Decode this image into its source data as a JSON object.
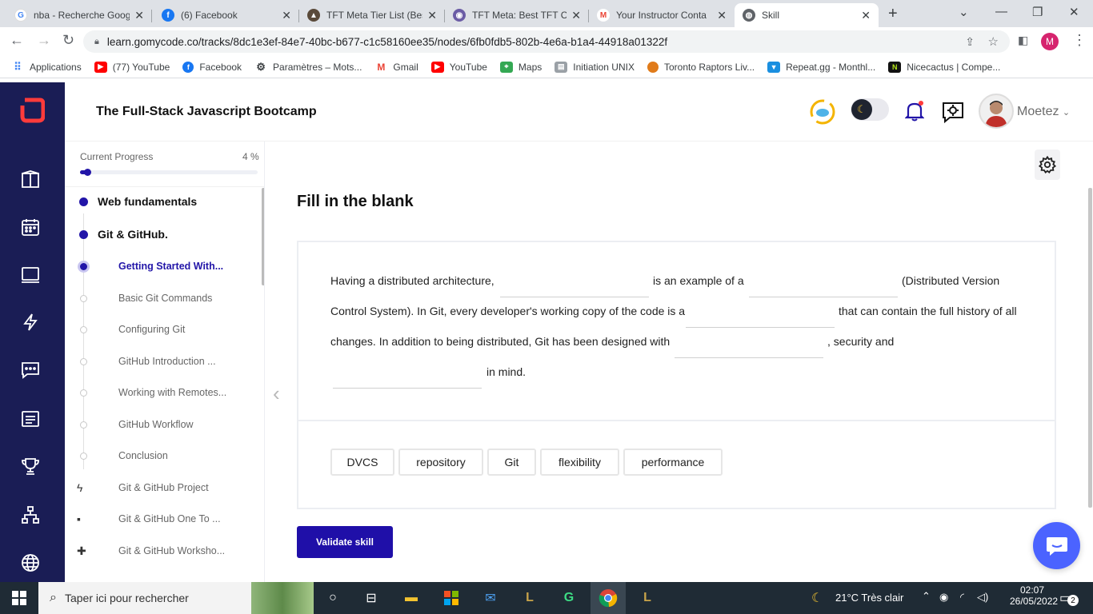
{
  "browser": {
    "tabs": [
      {
        "title": "nba - Recherche Goog",
        "favicon": "google-icon",
        "color": "#4285f4",
        "glyph": "G"
      },
      {
        "title": "(6) Facebook",
        "favicon": "facebook-icon",
        "color": "#1877f2",
        "glyph": "f"
      },
      {
        "title": "TFT Meta Tier List (Bes",
        "favicon": "tft-icon",
        "color": "#5a4a3a",
        "glyph": "▲"
      },
      {
        "title": "TFT Meta: Best TFT Co",
        "favicon": "tft-meta-icon",
        "color": "#6b5ca5",
        "glyph": "◉"
      },
      {
        "title": "Your Instructor Conta",
        "favicon": "gmail-icon",
        "color": "#ea4335",
        "glyph": "M"
      },
      {
        "title": "Skill",
        "favicon": "globe-icon",
        "color": "#5f6368",
        "glyph": "◍"
      }
    ],
    "url": "learn.gomycode.co/tracks/8dc1e3ef-84e7-40bc-b677-c1c58160ee35/nodes/6fb0fdb5-802b-4e6a-b1a4-44918a01322f",
    "profile_initial": "M",
    "bookmarks": [
      {
        "label": "Applications",
        "icon": "apps-grid-icon",
        "color": "#4285f4"
      },
      {
        "label": "(77) YouTube",
        "icon": "youtube-icon",
        "color": "#ff0000"
      },
      {
        "label": "Facebook",
        "icon": "facebook-icon",
        "color": "#1877f2"
      },
      {
        "label": "Paramètres – Mots...",
        "icon": "gear-icon",
        "color": "#3c4043"
      },
      {
        "label": "Gmail",
        "icon": "gmail-icon",
        "color": "#ea4335"
      },
      {
        "label": "YouTube",
        "icon": "youtube-icon",
        "color": "#ff0000"
      },
      {
        "label": "Maps",
        "icon": "maps-icon",
        "color": "#34a853"
      },
      {
        "label": "Initiation UNIX",
        "icon": "unix-icon",
        "color": "#888888"
      },
      {
        "label": "Toronto Raptors Liv...",
        "icon": "basketball-icon",
        "color": "#e07b1a"
      },
      {
        "label": "Repeat.gg - Monthl...",
        "icon": "repeat-icon",
        "color": "#1a8fe0"
      },
      {
        "label": "Nicecactus | Compe...",
        "icon": "nicecactus-icon",
        "color": "#111111"
      }
    ]
  },
  "app": {
    "course_title": "The Full-Stack Javascript Bootcamp",
    "user_name": "Moetez",
    "progress_label": "Current Progress",
    "progress_value": "4 %",
    "progress_fraction": 0.04,
    "sidebar": [
      {
        "label": "Web fundamentals",
        "level": "top",
        "state": "filled"
      },
      {
        "label": "Git & GitHub.",
        "level": "top",
        "state": "filled"
      },
      {
        "label": "Getting Started With...",
        "level": "sub",
        "state": "current"
      },
      {
        "label": "Basic Git Commands",
        "level": "sub",
        "state": "hollow"
      },
      {
        "label": "Configuring Git",
        "level": "sub",
        "state": "hollow"
      },
      {
        "label": "GitHub Introduction ...",
        "level": "sub",
        "state": "hollow"
      },
      {
        "label": "Working with Remotes...",
        "level": "sub",
        "state": "hollow"
      },
      {
        "label": "GitHub Workflow",
        "level": "sub",
        "state": "hollow"
      },
      {
        "label": "Conclusion",
        "level": "sub",
        "state": "hollow"
      },
      {
        "label": "Git & GitHub Project",
        "level": "sub",
        "state": "lightning"
      },
      {
        "label": "Git & GitHub One To ...",
        "level": "sub",
        "state": "chat"
      },
      {
        "label": "Git & GitHub Worksho...",
        "level": "sub",
        "state": "puzzle"
      }
    ],
    "exercise": {
      "title": "Fill in the blank",
      "line1_a": "Having a distributed architecture,",
      "line1_b": "is an example of a",
      "line1_c": "(Distributed Version",
      "line2_a": "Control System). In Git, every developer's working copy of the code is a",
      "line2_b": "that can contain the full history of all",
      "line3_a": "changes. In addition to being distributed, Git has been designed with",
      "line3_b": ", security and",
      "line4_a": "in mind.",
      "options": [
        "DVCS",
        "repository",
        "Git",
        "flexibility",
        "performance"
      ],
      "validate_label": "Validate skill"
    }
  },
  "taskbar": {
    "search_placeholder": "Taper ici pour rechercher",
    "weather": "21°C  Très clair",
    "time": "02:07",
    "date": "26/05/2022",
    "notifications": "2"
  }
}
